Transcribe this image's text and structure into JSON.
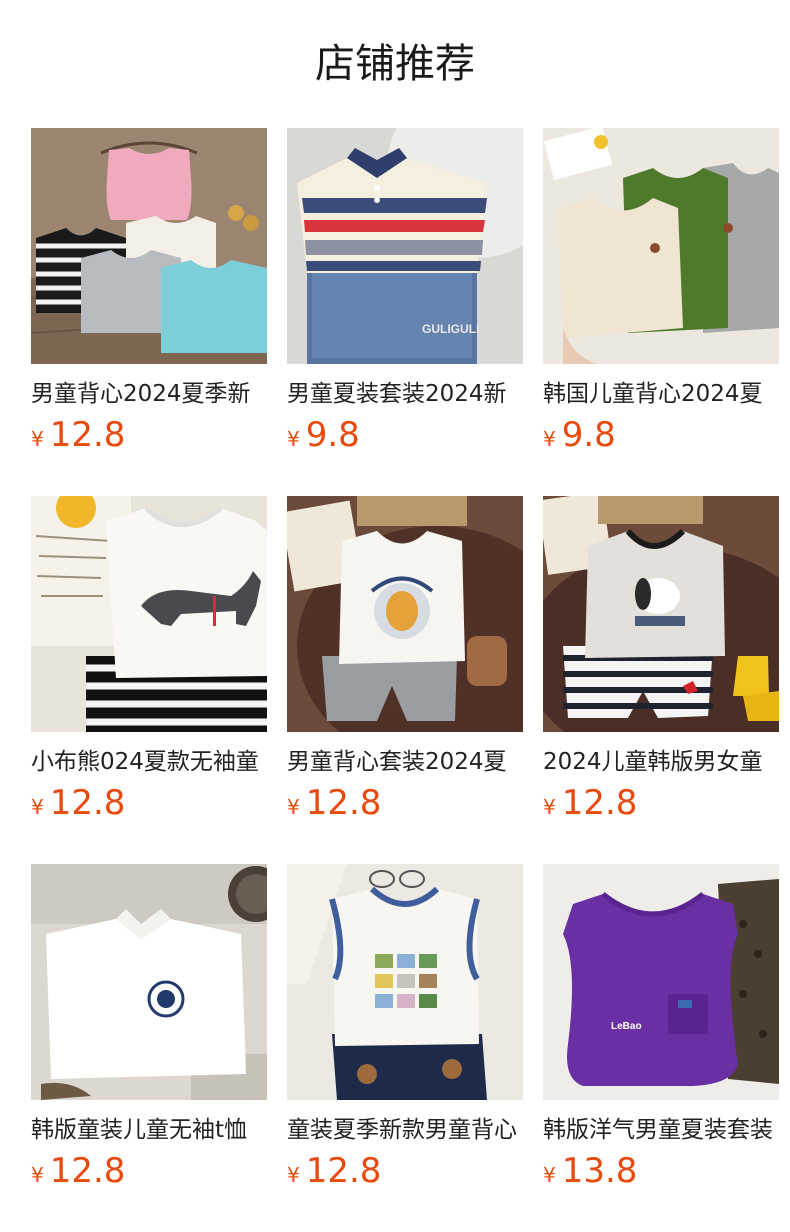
{
  "header": {
    "title": "店铺推荐"
  },
  "currency_symbol": "¥",
  "colors": {
    "price": "#e84a0c",
    "title": "#1a1a1a"
  },
  "products": [
    {
      "name": "男童背心2024夏季新",
      "price": "12.8",
      "image": "kids-tank-tops-pink-striped-grey-teal"
    },
    {
      "name": "男童夏装套装2024新",
      "price": "9.8",
      "image": "striped-polo-with-denim-shorts",
      "image_text": "GULIGULI"
    },
    {
      "name": "韩国儿童背心2024夏",
      "price": "9.8",
      "image": "beige-green-grey-ribbed-tank-tops"
    },
    {
      "name": "小布熊024夏款无袖童",
      "price": "12.8",
      "image": "white-tank-dog-print-striped-shorts"
    },
    {
      "name": "男童背心套装2024夏",
      "price": "12.8",
      "image": "white-tank-cartoon-print-grey-shorts"
    },
    {
      "name": "2024儿童韩版男女童",
      "price": "12.8",
      "image": "grey-tank-dog-print-striped-shorts"
    },
    {
      "name": "韩版童装儿童无袖t恤",
      "price": "12.8",
      "image": "white-sleeveless-polo-badge"
    },
    {
      "name": "童装夏季新款男童背心",
      "price": "12.8",
      "image": "white-tank-blue-trim-with-navy-shorts"
    },
    {
      "name": "韩版洋气男童夏装套装",
      "price": "13.8",
      "image": "purple-tank-pocket-leopard-shorts",
      "image_text": "LeBao"
    }
  ]
}
